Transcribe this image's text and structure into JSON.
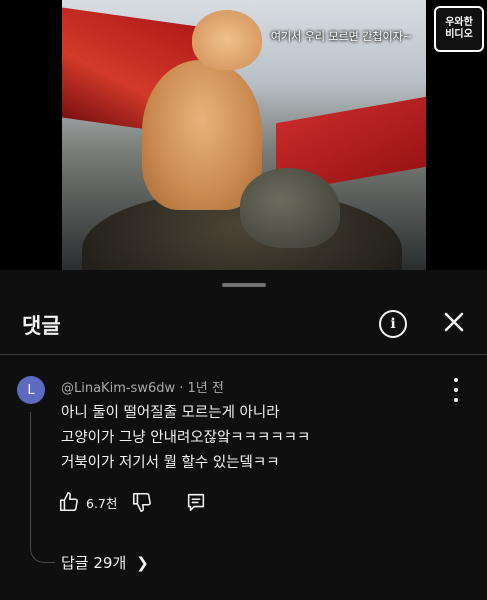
{
  "video": {
    "caption": "여기서 우리 모르면 간첩이자~",
    "channel_logo_lines": [
      "우와한",
      "비디오"
    ]
  },
  "header": {
    "title": "댓글",
    "info_icon": "info-icon",
    "close_icon": "close-icon"
  },
  "comment": {
    "avatar_letter": "L",
    "avatar_color": "#5c6bc0",
    "author": "@LinaKim-sw6dw",
    "time": "1년 전",
    "lines": [
      "아니 둘이 떨어질줄 모르는게 아니라",
      "고양이가 그냥 안내려오잖앜ㅋㅋㅋㅋㅋㅋ",
      "거북이가 저기서 뭘 할수 있는뎈ㅋㅋ"
    ],
    "like_count": "6.7천",
    "replies_label": "답글 29개"
  }
}
